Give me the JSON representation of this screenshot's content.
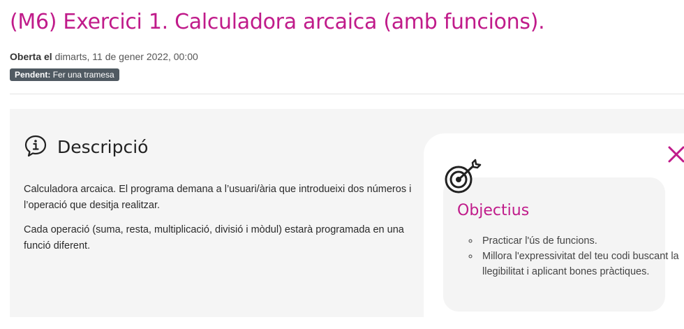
{
  "header": {
    "title": "(M6) Exercici 1. Calculadora arcaica (amb funcions).",
    "opened_label": "Oberta el",
    "opened_value": "dimarts, 11 de gener 2022, 00:00",
    "status_label": "Pendent:",
    "status_value": "Fer una tramesa"
  },
  "description": {
    "heading": "Descripció",
    "icon": "info-speech-icon",
    "paragraphs": [
      "Calculadora arcaica. El programa demana a l’usuari/ària que introdueixi dos números i l’operació que desitja realitzar.",
      "Cada operació (suma, resta, multiplicació, divisió i mòdul) estarà programada en una funció diferent."
    ]
  },
  "objectives": {
    "title": "Objectius",
    "icon": "target-icon",
    "close_icon": "close-icon",
    "items": [
      "Practicar l'ús de funcions.",
      "Millora l'expressivitat del teu codi buscant la llegibilitat i aplicant bones pràctiques."
    ]
  },
  "colors": {
    "accent": "#c01b8a",
    "badge_bg": "#505a62",
    "panel_bg": "#f5f5f5"
  }
}
